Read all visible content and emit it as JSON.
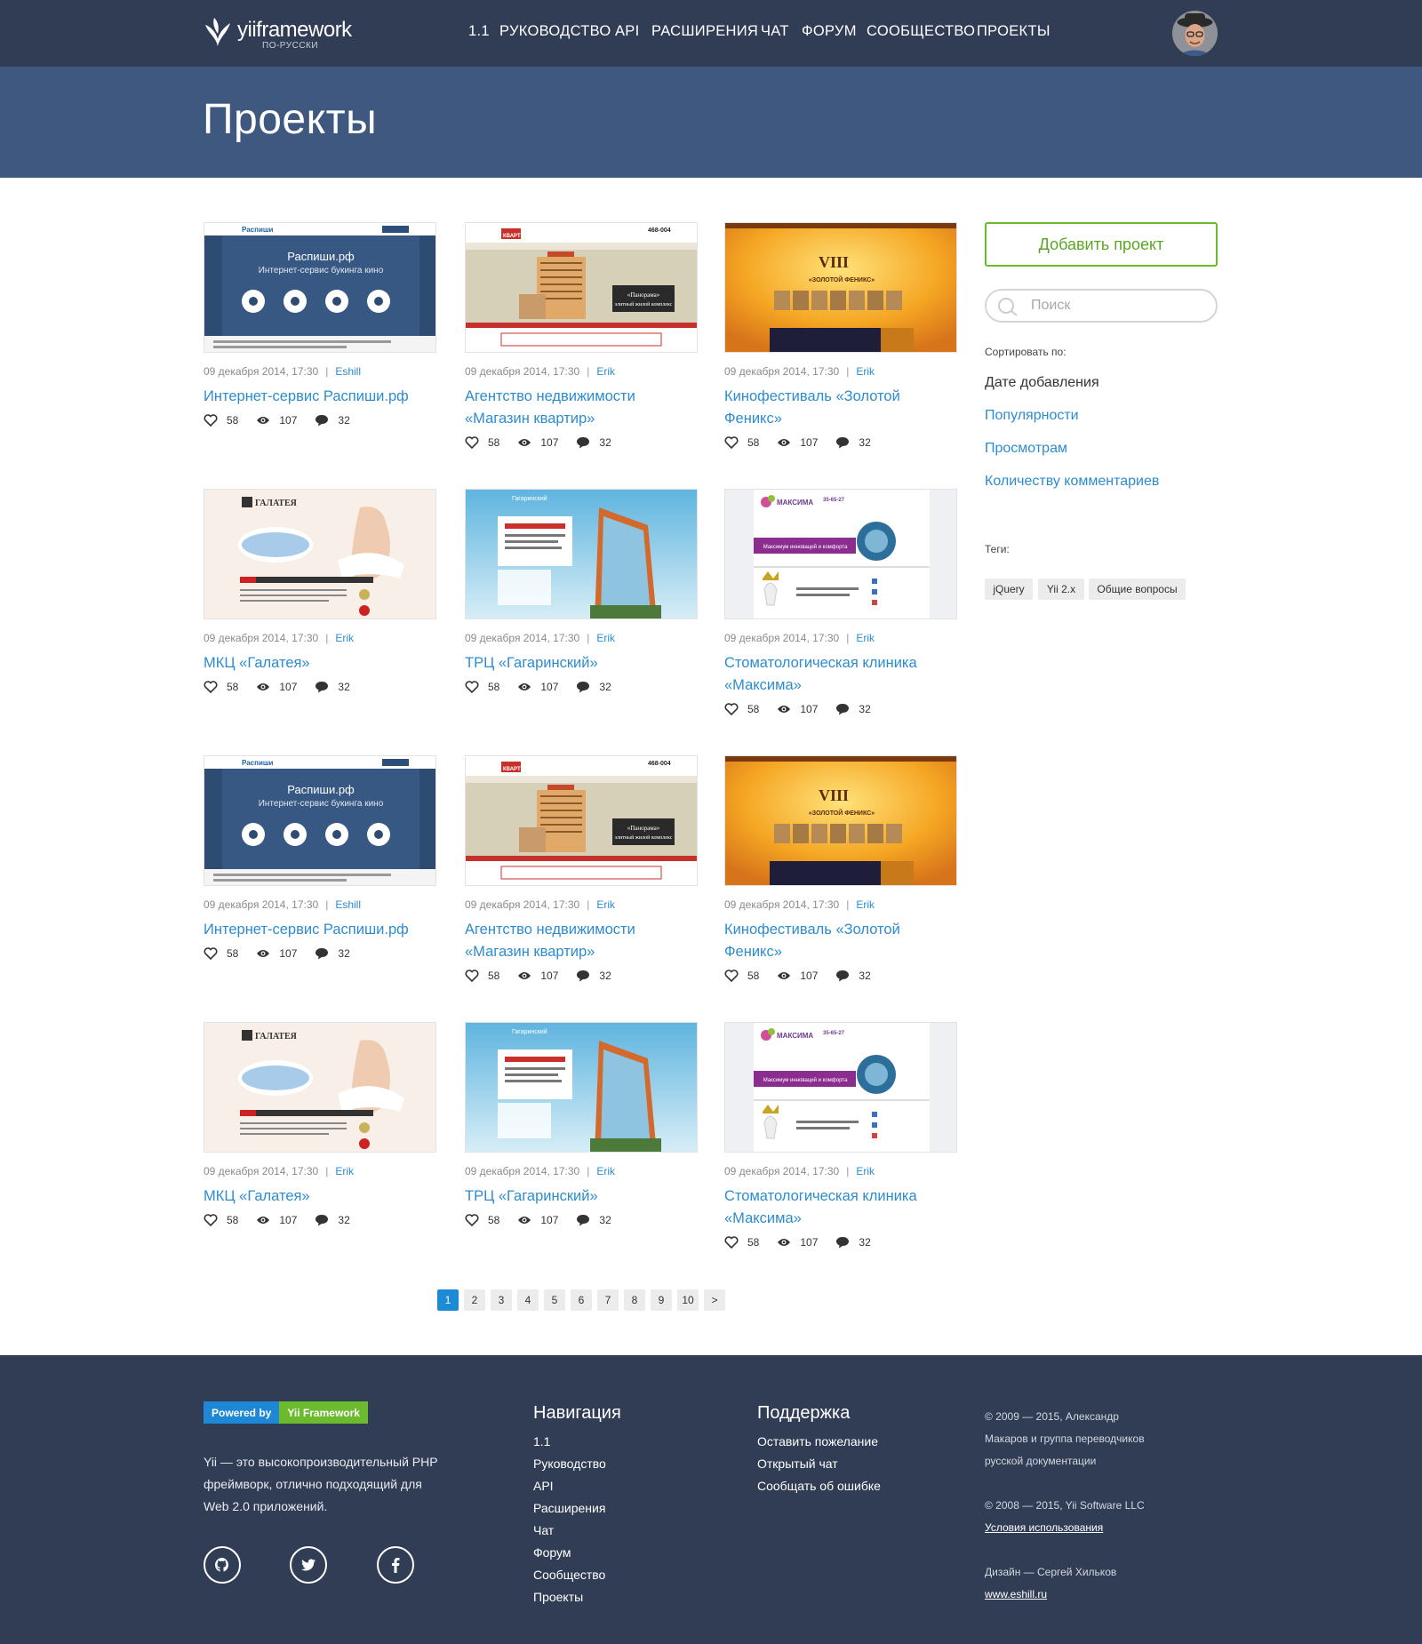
{
  "header": {
    "logo_text": "yiiframework",
    "logo_sub": "ПО-РУССКИ",
    "nav": [
      {
        "label": "1.1"
      },
      {
        "label": "РУКОВОДСТВО"
      },
      {
        "label": "API"
      },
      {
        "label": "РАСШИРЕНИЯ"
      },
      {
        "label": "ЧАТ"
      },
      {
        "label": "ФОРУМ"
      },
      {
        "label": "СООБЩЕСТВО"
      },
      {
        "label": "ПРОЕКТЫ"
      }
    ],
    "avatar_icon": "user-avatar"
  },
  "page": {
    "title": "Проекты"
  },
  "projects": [
    {
      "date": "09 декабря 2014, 17:30",
      "author": "Eshill",
      "title": "Интернет-сервис Распиши.рф",
      "likes": "58",
      "views": "107",
      "comments": "32",
      "thumb": "raspishi"
    },
    {
      "date": "09 декабря 2014, 17:30",
      "author": "Erik",
      "title": "Агентство недвижимости «Магазин квартир»",
      "likes": "58",
      "views": "107",
      "comments": "32",
      "thumb": "kvartir"
    },
    {
      "date": "09 декабря 2014, 17:30",
      "author": "Erik",
      "title": "Кинофестиваль «Золотой Феникс»",
      "likes": "58",
      "views": "107",
      "comments": "32",
      "thumb": "feniks"
    },
    {
      "date": "09 декабря 2014, 17:30",
      "author": "Erik",
      "title": "МКЦ «Галатея»",
      "likes": "58",
      "views": "107",
      "comments": "32",
      "thumb": "galateya"
    },
    {
      "date": "09 декабря 2014, 17:30",
      "author": "Erik",
      "title": "ТРЦ «Гагаринский»",
      "likes": "58",
      "views": "107",
      "comments": "32",
      "thumb": "gagarin"
    },
    {
      "date": "09 декабря 2014, 17:30",
      "author": "Erik",
      "title": "Стоматологическая клиника «Максима»",
      "likes": "58",
      "views": "107",
      "comments": "32",
      "thumb": "maksima"
    },
    {
      "date": "09 декабря 2014, 17:30",
      "author": "Eshill",
      "title": "Интернет-сервис Распиши.рф",
      "likes": "58",
      "views": "107",
      "comments": "32",
      "thumb": "raspishi"
    },
    {
      "date": "09 декабря 2014, 17:30",
      "author": "Erik",
      "title": "Агентство недвижимости «Магазин квартир»",
      "likes": "58",
      "views": "107",
      "comments": "32",
      "thumb": "kvartir"
    },
    {
      "date": "09 декабря 2014, 17:30",
      "author": "Erik",
      "title": "Кинофестиваль «Золотой Феникс»",
      "likes": "58",
      "views": "107",
      "comments": "32",
      "thumb": "feniks"
    },
    {
      "date": "09 декабря 2014, 17:30",
      "author": "Erik",
      "title": "МКЦ «Галатея»",
      "likes": "58",
      "views": "107",
      "comments": "32",
      "thumb": "galateya"
    },
    {
      "date": "09 декабря 2014, 17:30",
      "author": "Erik",
      "title": "ТРЦ «Гагаринский»",
      "likes": "58",
      "views": "107",
      "comments": "32",
      "thumb": "gagarin"
    },
    {
      "date": "09 декабря 2014, 17:30",
      "author": "Erik",
      "title": "Стоматологическая клиника «Максима»",
      "likes": "58",
      "views": "107",
      "comments": "32",
      "thumb": "maksima"
    }
  ],
  "thumb_text": {
    "raspishi_brand": "Распиши",
    "raspishi_title": "Распиши.рф",
    "raspishi_sub": "Интернет-сервис букинга кино",
    "kvartir_brand": "КВАРТИР",
    "kvartir_phone": "468-004",
    "kvartir_caption": "«Панорама»",
    "kvartir_caption2": "элитный жилой комплекс",
    "feniks_title": "VIII",
    "feniks_sub": "«ЗОЛОТОЙ ФЕНИКС»",
    "galateya_brand": "ГАЛАТЕЯ",
    "gagarin_brand": "Гагаринский",
    "maksima_brand": "МАКСИМА",
    "maksima_phone": "35-65-27",
    "maksima_banner": "Максимум инноваций и комфорта"
  },
  "sidebar": {
    "add_button": "Добавить проект",
    "search_placeholder": "Поиск",
    "sort_label": "Сортировать по:",
    "sort_options": [
      {
        "label": "Дате добавления",
        "active": true
      },
      {
        "label": "Популярности"
      },
      {
        "label": "Просмотрам"
      },
      {
        "label": "Количеству комментариев"
      }
    ],
    "tags_label": "Теги:",
    "tags": [
      {
        "label": "jQuery"
      },
      {
        "label": "Yii 2.x"
      },
      {
        "label": "Общие вопросы"
      }
    ]
  },
  "pagination": {
    "pages": [
      "1",
      "2",
      "3",
      "4",
      "5",
      "6",
      "7",
      "8",
      "9",
      "10"
    ],
    "current": "1",
    "next": ">"
  },
  "footer": {
    "badge_left": "Powered by",
    "badge_right": "Yii Framework",
    "description": "Yii — это высокопроизводительный PHP фреймворк, отлично подходящий для Web 2.0 приложений.",
    "social": [
      "github-icon",
      "twitter-icon",
      "facebook-icon"
    ],
    "nav_title": "Навигация",
    "nav_links": [
      {
        "label": "1.1"
      },
      {
        "label": "Руководство"
      },
      {
        "label": "API"
      },
      {
        "label": "Расширения"
      },
      {
        "label": "Чат"
      },
      {
        "label": "Форум"
      },
      {
        "label": "Сообщество"
      },
      {
        "label": "Проекты"
      }
    ],
    "support_title": "Поддержка",
    "support_links": [
      {
        "label": "Оставить пожелание"
      },
      {
        "label": "Открытый чат"
      },
      {
        "label": "Сообщать об ошибке"
      }
    ],
    "copyright1": "© 2009 — 2015, Александр Макаров и группа переводчиков русской документации",
    "copyright2": "© 2008 — 2015, Yii Software LLC",
    "terms": "Условия использования",
    "design": "Дизайн — Сергей Хильков",
    "design_link": "www.eshill.ru"
  },
  "colors": {
    "topbar": "#313d55",
    "header_band": "#3e5880",
    "link": "#2d8ccf",
    "accent_green": "#6cba2e",
    "pager_active": "#1d8ad6"
  }
}
